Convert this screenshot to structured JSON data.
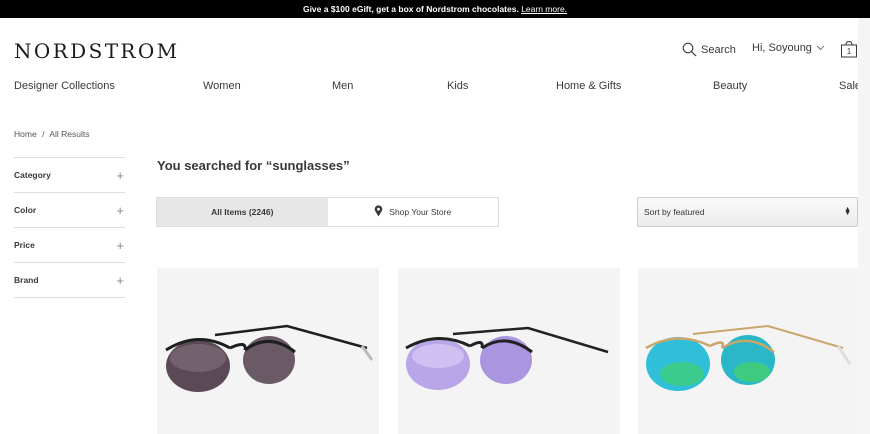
{
  "promo": {
    "text": "Give a $100 eGift, get a box of Nordstrom chocolates.",
    "link": "Learn more."
  },
  "header": {
    "logo": "NORDSTROM",
    "search_label": "Search",
    "account_label": "Hi, Soyoung",
    "bag_count": "1"
  },
  "nav": [
    "Designer Collections",
    "Women",
    "Men",
    "Kids",
    "Home & Gifts",
    "Beauty",
    "Sale"
  ],
  "breadcrumb": {
    "home": "Home",
    "separator": "/",
    "current": "All Results"
  },
  "filters": [
    "Category",
    "Color",
    "Price",
    "Brand"
  ],
  "filter_toggle": "+",
  "results": {
    "heading": "You searched for “sunglasses”",
    "tab_all": "All Items (2246)",
    "tab_store": "Shop Your Store",
    "sort": "Sort by featured"
  },
  "products": [
    {
      "name": "aviator-sunglasses-black-gradient",
      "lens_color": "#5b4a56",
      "frame_color": "#1e1e1e"
    },
    {
      "name": "aviator-sunglasses-purple-mirror",
      "lens_color": "#b9a6e8",
      "frame_color": "#222222"
    },
    {
      "name": "aviator-sunglasses-green-mirror",
      "lens_color": "#2fbfd8",
      "frame_color": "#c9a66b"
    }
  ]
}
